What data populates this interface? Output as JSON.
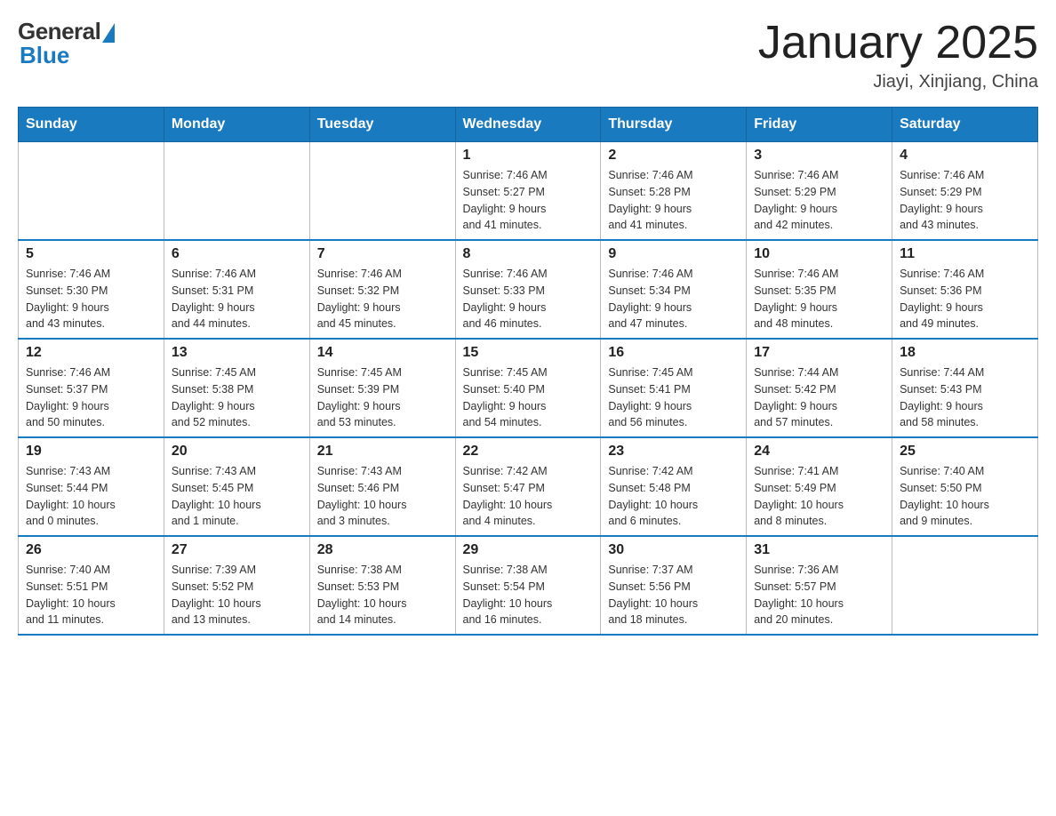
{
  "header": {
    "logo_general": "General",
    "logo_blue": "Blue",
    "month_title": "January 2025",
    "location": "Jiayi, Xinjiang, China"
  },
  "weekdays": [
    "Sunday",
    "Monday",
    "Tuesday",
    "Wednesday",
    "Thursday",
    "Friday",
    "Saturday"
  ],
  "weeks": [
    [
      {
        "day": "",
        "info": ""
      },
      {
        "day": "",
        "info": ""
      },
      {
        "day": "",
        "info": ""
      },
      {
        "day": "1",
        "info": "Sunrise: 7:46 AM\nSunset: 5:27 PM\nDaylight: 9 hours\nand 41 minutes."
      },
      {
        "day": "2",
        "info": "Sunrise: 7:46 AM\nSunset: 5:28 PM\nDaylight: 9 hours\nand 41 minutes."
      },
      {
        "day": "3",
        "info": "Sunrise: 7:46 AM\nSunset: 5:29 PM\nDaylight: 9 hours\nand 42 minutes."
      },
      {
        "day": "4",
        "info": "Sunrise: 7:46 AM\nSunset: 5:29 PM\nDaylight: 9 hours\nand 43 minutes."
      }
    ],
    [
      {
        "day": "5",
        "info": "Sunrise: 7:46 AM\nSunset: 5:30 PM\nDaylight: 9 hours\nand 43 minutes."
      },
      {
        "day": "6",
        "info": "Sunrise: 7:46 AM\nSunset: 5:31 PM\nDaylight: 9 hours\nand 44 minutes."
      },
      {
        "day": "7",
        "info": "Sunrise: 7:46 AM\nSunset: 5:32 PM\nDaylight: 9 hours\nand 45 minutes."
      },
      {
        "day": "8",
        "info": "Sunrise: 7:46 AM\nSunset: 5:33 PM\nDaylight: 9 hours\nand 46 minutes."
      },
      {
        "day": "9",
        "info": "Sunrise: 7:46 AM\nSunset: 5:34 PM\nDaylight: 9 hours\nand 47 minutes."
      },
      {
        "day": "10",
        "info": "Sunrise: 7:46 AM\nSunset: 5:35 PM\nDaylight: 9 hours\nand 48 minutes."
      },
      {
        "day": "11",
        "info": "Sunrise: 7:46 AM\nSunset: 5:36 PM\nDaylight: 9 hours\nand 49 minutes."
      }
    ],
    [
      {
        "day": "12",
        "info": "Sunrise: 7:46 AM\nSunset: 5:37 PM\nDaylight: 9 hours\nand 50 minutes."
      },
      {
        "day": "13",
        "info": "Sunrise: 7:45 AM\nSunset: 5:38 PM\nDaylight: 9 hours\nand 52 minutes."
      },
      {
        "day": "14",
        "info": "Sunrise: 7:45 AM\nSunset: 5:39 PM\nDaylight: 9 hours\nand 53 minutes."
      },
      {
        "day": "15",
        "info": "Sunrise: 7:45 AM\nSunset: 5:40 PM\nDaylight: 9 hours\nand 54 minutes."
      },
      {
        "day": "16",
        "info": "Sunrise: 7:45 AM\nSunset: 5:41 PM\nDaylight: 9 hours\nand 56 minutes."
      },
      {
        "day": "17",
        "info": "Sunrise: 7:44 AM\nSunset: 5:42 PM\nDaylight: 9 hours\nand 57 minutes."
      },
      {
        "day": "18",
        "info": "Sunrise: 7:44 AM\nSunset: 5:43 PM\nDaylight: 9 hours\nand 58 minutes."
      }
    ],
    [
      {
        "day": "19",
        "info": "Sunrise: 7:43 AM\nSunset: 5:44 PM\nDaylight: 10 hours\nand 0 minutes."
      },
      {
        "day": "20",
        "info": "Sunrise: 7:43 AM\nSunset: 5:45 PM\nDaylight: 10 hours\nand 1 minute."
      },
      {
        "day": "21",
        "info": "Sunrise: 7:43 AM\nSunset: 5:46 PM\nDaylight: 10 hours\nand 3 minutes."
      },
      {
        "day": "22",
        "info": "Sunrise: 7:42 AM\nSunset: 5:47 PM\nDaylight: 10 hours\nand 4 minutes."
      },
      {
        "day": "23",
        "info": "Sunrise: 7:42 AM\nSunset: 5:48 PM\nDaylight: 10 hours\nand 6 minutes."
      },
      {
        "day": "24",
        "info": "Sunrise: 7:41 AM\nSunset: 5:49 PM\nDaylight: 10 hours\nand 8 minutes."
      },
      {
        "day": "25",
        "info": "Sunrise: 7:40 AM\nSunset: 5:50 PM\nDaylight: 10 hours\nand 9 minutes."
      }
    ],
    [
      {
        "day": "26",
        "info": "Sunrise: 7:40 AM\nSunset: 5:51 PM\nDaylight: 10 hours\nand 11 minutes."
      },
      {
        "day": "27",
        "info": "Sunrise: 7:39 AM\nSunset: 5:52 PM\nDaylight: 10 hours\nand 13 minutes."
      },
      {
        "day": "28",
        "info": "Sunrise: 7:38 AM\nSunset: 5:53 PM\nDaylight: 10 hours\nand 14 minutes."
      },
      {
        "day": "29",
        "info": "Sunrise: 7:38 AM\nSunset: 5:54 PM\nDaylight: 10 hours\nand 16 minutes."
      },
      {
        "day": "30",
        "info": "Sunrise: 7:37 AM\nSunset: 5:56 PM\nDaylight: 10 hours\nand 18 minutes."
      },
      {
        "day": "31",
        "info": "Sunrise: 7:36 AM\nSunset: 5:57 PM\nDaylight: 10 hours\nand 20 minutes."
      },
      {
        "day": "",
        "info": ""
      }
    ]
  ]
}
